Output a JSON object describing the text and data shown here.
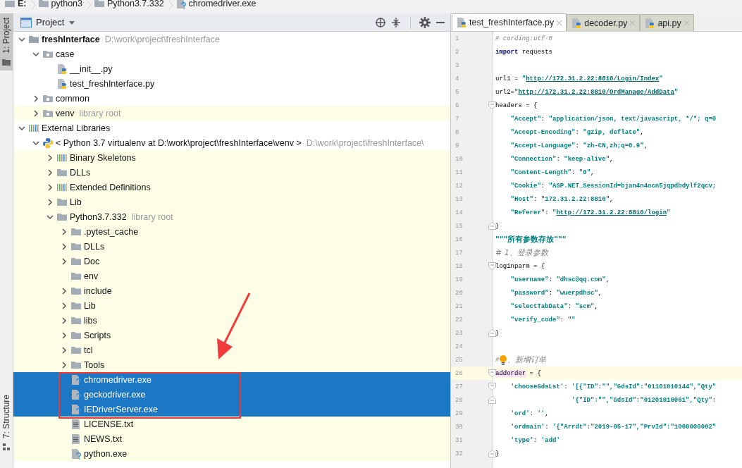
{
  "breadcrumb": [
    {
      "label": "E:",
      "kind": "drive"
    },
    {
      "label": "python3",
      "kind": "folder"
    },
    {
      "label": "Python3.7.332",
      "kind": "folder"
    },
    {
      "label": "chromedriver.exe",
      "kind": "unknown-file"
    }
  ],
  "tool_strip": [
    {
      "label": "1: Project",
      "selected": true,
      "kind": "project"
    },
    {
      "label": "7: Structure",
      "selected": false,
      "kind": "structure"
    }
  ],
  "project_panel": {
    "title": "Project",
    "tree": [
      {
        "label": "freshInterface",
        "hint": "D:\\work\\project\\freshInterface",
        "kind": "project",
        "expanded": true,
        "library": false,
        "selected": false,
        "children": [
          {
            "label": "case",
            "kind": "module-folder",
            "expanded": true,
            "library": false,
            "selected": false,
            "children": [
              {
                "label": "__init__.py",
                "kind": "python-file",
                "library": false,
                "selected": false
              },
              {
                "label": "test_freshInterface.py",
                "kind": "python-file",
                "library": false,
                "selected": false
              }
            ]
          },
          {
            "label": "common",
            "kind": "module-folder",
            "expanded": false,
            "library": false,
            "selected": false
          },
          {
            "label": "venv",
            "hint": "library root",
            "kind": "module-folder",
            "expanded": false,
            "library": true,
            "selected": false
          }
        ]
      },
      {
        "label": "External Libraries",
        "kind": "library",
        "expanded": true,
        "library": false,
        "selected": false,
        "children": [
          {
            "label": "< Python 3.7 virtualenv at D:\\work\\project\\freshInterface\\venv >",
            "hint": "D:\\work\\project\\freshInterface\\",
            "kind": "python-sdk",
            "expanded": true,
            "library": false,
            "selected": false,
            "children": [
              {
                "label": "Binary Skeletons",
                "kind": "library",
                "expanded": false,
                "library": true,
                "selected": false
              },
              {
                "label": "DLLs",
                "kind": "folder",
                "expanded": false,
                "library": true,
                "selected": false
              },
              {
                "label": "Extended Definitions",
                "kind": "library",
                "expanded": false,
                "library": true,
                "selected": false
              },
              {
                "label": "Lib",
                "kind": "folder",
                "expanded": false,
                "library": true,
                "selected": false
              },
              {
                "label": "Python3.7.332",
                "hint": "library root",
                "kind": "folder",
                "expanded": true,
                "library": true,
                "selected": false,
                "children": [
                  {
                    "label": ".pytest_cache",
                    "kind": "folder",
                    "expanded": false,
                    "library": true,
                    "selected": false
                  },
                  {
                    "label": "DLLs",
                    "kind": "folder",
                    "expanded": false,
                    "library": true,
                    "selected": false
                  },
                  {
                    "label": "Doc",
                    "kind": "folder",
                    "expanded": false,
                    "library": true,
                    "selected": false
                  },
                  {
                    "label": "env",
                    "kind": "folder",
                    "library": true,
                    "selected": false
                  },
                  {
                    "label": "include",
                    "kind": "folder",
                    "expanded": false,
                    "library": true,
                    "selected": false
                  },
                  {
                    "label": "Lib",
                    "kind": "folder",
                    "expanded": false,
                    "library": true,
                    "selected": false
                  },
                  {
                    "label": "libs",
                    "kind": "folder",
                    "expanded": false,
                    "library": true,
                    "selected": false
                  },
                  {
                    "label": "Scripts",
                    "kind": "folder",
                    "expanded": false,
                    "library": true,
                    "selected": false
                  },
                  {
                    "label": "tcl",
                    "kind": "folder",
                    "expanded": false,
                    "library": true,
                    "selected": false
                  },
                  {
                    "label": "Tools",
                    "kind": "folder",
                    "expanded": false,
                    "library": true,
                    "selected": false
                  },
                  {
                    "label": "chromedriver.exe",
                    "kind": "unknown-file",
                    "selected": true
                  },
                  {
                    "label": "geckodriver.exe",
                    "kind": "unknown-file",
                    "selected": true
                  },
                  {
                    "label": "IEDriverServer.exe",
                    "kind": "unknown-file",
                    "selected": true
                  },
                  {
                    "label": "LICENSE.txt",
                    "kind": "text-file",
                    "library": true,
                    "selected": false
                  },
                  {
                    "label": "NEWS.txt",
                    "kind": "text-file",
                    "library": true,
                    "selected": false
                  },
                  {
                    "label": "python.exe",
                    "kind": "unknown-file",
                    "library": true,
                    "selected": false
                  }
                ]
              }
            ]
          }
        ]
      }
    ]
  },
  "editor": {
    "tabs": [
      {
        "label": "test_freshInterface.py",
        "selected": true
      },
      {
        "label": "decoder.py",
        "selected": false
      },
      {
        "label": "api.py",
        "selected": false
      }
    ],
    "lines": [
      {
        "number": "1",
        "kind": "code",
        "tokens": [
          {
            "kind": "comment",
            "text": "# cording:utf-8"
          }
        ]
      },
      {
        "number": "2",
        "kind": "code",
        "tokens": [
          {
            "kind": "keyword",
            "text": "import"
          },
          {
            "kind": "plain",
            "text": " requests"
          }
        ]
      },
      {
        "number": "3",
        "kind": "code"
      },
      {
        "number": "4",
        "kind": "code",
        "tokens": [
          {
            "kind": "plain",
            "text": "url1 = "
          },
          {
            "kind": "string",
            "text": "\""
          },
          {
            "kind": "link",
            "text": "http://172.31.2.22:8810/Login/Index"
          },
          {
            "kind": "string",
            "text": "\""
          }
        ]
      },
      {
        "number": "5",
        "kind": "code",
        "tokens": [
          {
            "kind": "plain",
            "text": "url2="
          },
          {
            "kind": "string",
            "text": "\""
          },
          {
            "kind": "link",
            "text": "http://172.31.2.22:8810/OrdManage/AddData"
          },
          {
            "kind": "string",
            "text": "\""
          }
        ]
      },
      {
        "number": "6",
        "kind": "foldopen",
        "tokens": [
          {
            "kind": "plain",
            "text": "headers = {"
          }
        ]
      },
      {
        "number": "7",
        "kind": "code",
        "tokens": [
          {
            "kind": "string",
            "text": "    \"Accept\""
          },
          {
            "kind": "plain",
            "text": ": "
          },
          {
            "kind": "string",
            "text": "\"application/json, text/javascript, */*; q=0"
          }
        ]
      },
      {
        "number": "8",
        "kind": "code",
        "tokens": [
          {
            "kind": "string",
            "text": "    \"Accept-Encoding\""
          },
          {
            "kind": "plain",
            "text": ": "
          },
          {
            "kind": "string",
            "text": "\"gzip, deflate\""
          },
          {
            "kind": "plain",
            "text": ","
          }
        ]
      },
      {
        "number": "9",
        "kind": "code",
        "tokens": [
          {
            "kind": "string",
            "text": "    \"Accept-Language\""
          },
          {
            "kind": "plain",
            "text": ": "
          },
          {
            "kind": "string",
            "text": "\"zh-CN,zh;q=0.9\""
          },
          {
            "kind": "plain",
            "text": ","
          }
        ]
      },
      {
        "number": "10",
        "kind": "code",
        "tokens": [
          {
            "kind": "string",
            "text": "    \"Connection\""
          },
          {
            "kind": "plain",
            "text": ": "
          },
          {
            "kind": "string",
            "text": "\"keep-alive\""
          },
          {
            "kind": "plain",
            "text": ","
          }
        ]
      },
      {
        "number": "11",
        "kind": "code",
        "tokens": [
          {
            "kind": "string",
            "text": "    \"Content-Length\""
          },
          {
            "kind": "plain",
            "text": ": "
          },
          {
            "kind": "string",
            "text": "\"0\""
          },
          {
            "kind": "plain",
            "text": ","
          }
        ]
      },
      {
        "number": "12",
        "kind": "code",
        "tokens": [
          {
            "kind": "string",
            "text": "    \"Cookie\""
          },
          {
            "kind": "plain",
            "text": ": "
          },
          {
            "kind": "string",
            "text": "\"ASP.NET_SessionId=bjan4n4ocn5jqpdbdylf2qcv;"
          }
        ]
      },
      {
        "number": "13",
        "kind": "code",
        "tokens": [
          {
            "kind": "string",
            "text": "    \"Host\""
          },
          {
            "kind": "plain",
            "text": ": "
          },
          {
            "kind": "string",
            "text": "\"172.31.2.22:8810\""
          },
          {
            "kind": "plain",
            "text": ","
          }
        ]
      },
      {
        "number": "14",
        "kind": "code",
        "tokens": [
          {
            "kind": "string",
            "text": "    \"Referer\""
          },
          {
            "kind": "plain",
            "text": ": "
          },
          {
            "kind": "string",
            "text": "\""
          },
          {
            "kind": "link",
            "text": "http://172.31.2.22:8810/login"
          },
          {
            "kind": "string",
            "text": "\""
          }
        ]
      },
      {
        "number": "15",
        "kind": "foldclose",
        "tokens": [
          {
            "kind": "plain",
            "text": "}"
          }
        ]
      },
      {
        "number": "16",
        "kind": "code",
        "tokens": [
          {
            "kind": "docstring",
            "text": "\"\"\"所有参数存放\"\"\""
          }
        ]
      },
      {
        "number": "17",
        "kind": "code",
        "tokens": [
          {
            "kind": "comment",
            "text": "# 1、登录参数"
          }
        ]
      },
      {
        "number": "18",
        "kind": "foldopen",
        "tokens": [
          {
            "kind": "plain",
            "text": "loginparm = {"
          }
        ]
      },
      {
        "number": "19",
        "kind": "code",
        "tokens": [
          {
            "kind": "string",
            "text": "    \"username\""
          },
          {
            "kind": "plain",
            "text": ": "
          },
          {
            "kind": "string",
            "text": "\"dhsc@qq.com\""
          },
          {
            "kind": "plain",
            "text": ","
          }
        ]
      },
      {
        "number": "20",
        "kind": "code",
        "tokens": [
          {
            "kind": "string",
            "text": "    \"password\""
          },
          {
            "kind": "plain",
            "text": ": "
          },
          {
            "kind": "string",
            "text": "\"wuerpdhsc\""
          },
          {
            "kind": "plain",
            "text": ","
          }
        ]
      },
      {
        "number": "21",
        "kind": "code",
        "tokens": [
          {
            "kind": "string",
            "text": "    \"selectTabData\""
          },
          {
            "kind": "plain",
            "text": ": "
          },
          {
            "kind": "string",
            "text": "\"scm\""
          },
          {
            "kind": "plain",
            "text": ","
          }
        ]
      },
      {
        "number": "22",
        "kind": "code",
        "tokens": [
          {
            "kind": "string",
            "text": "    \"verify_code\""
          },
          {
            "kind": "plain",
            "text": ": "
          },
          {
            "kind": "string",
            "text": "\"\""
          }
        ]
      },
      {
        "number": "23",
        "kind": "foldclose",
        "tokens": [
          {
            "kind": "plain",
            "text": "}"
          }
        ]
      },
      {
        "number": "24",
        "kind": "code"
      },
      {
        "number": "25",
        "kind": "code",
        "tokens": [
          {
            "kind": "comment",
            "text": "#"
          },
          {
            "kind": "bulb"
          },
          {
            "kind": "comment",
            "text": "、新增订单"
          }
        ]
      },
      {
        "number": "26",
        "kind": "foldopen",
        "current": true,
        "tokens": [
          {
            "kind": "highlight",
            "text": "addorder"
          },
          {
            "kind": "plain",
            "text": " = {"
          }
        ]
      },
      {
        "number": "27",
        "kind": "foldopen",
        "tokens": [
          {
            "kind": "string",
            "text": "    'chooseGdsLst'"
          },
          {
            "kind": "plain",
            "text": ": "
          },
          {
            "kind": "string",
            "text": "'[{\"ID\":\"\",\"GdsId\":\"01101010144\",\"Qty\""
          }
        ]
      },
      {
        "number": "28",
        "kind": "foldclose",
        "tokens": [
          {
            "kind": "string",
            "text": "                    '{\"ID\":\"\",\"GdsId\":\"01201010061\",\"Qty\":"
          }
        ]
      },
      {
        "number": "29",
        "kind": "code",
        "tokens": [
          {
            "kind": "string",
            "text": "    'ord'"
          },
          {
            "kind": "plain",
            "text": ": "
          },
          {
            "kind": "string",
            "text": "''"
          },
          {
            "kind": "plain",
            "text": ","
          }
        ]
      },
      {
        "number": "30",
        "kind": "code",
        "tokens": [
          {
            "kind": "string",
            "text": "    'ordmain'"
          },
          {
            "kind": "plain",
            "text": ": "
          },
          {
            "kind": "string",
            "text": "'{\"Arrdt\":\"2019-05-17\",\"PrvId\":\"1000000002\""
          }
        ]
      },
      {
        "number": "31",
        "kind": "code",
        "tokens": [
          {
            "kind": "string",
            "text": "    'type'"
          },
          {
            "kind": "plain",
            "text": ": "
          },
          {
            "kind": "string",
            "text": "'add'"
          }
        ]
      },
      {
        "number": "32",
        "kind": "foldclose",
        "tokens": [
          {
            "kind": "plain",
            "text": "}"
          }
        ]
      }
    ]
  }
}
